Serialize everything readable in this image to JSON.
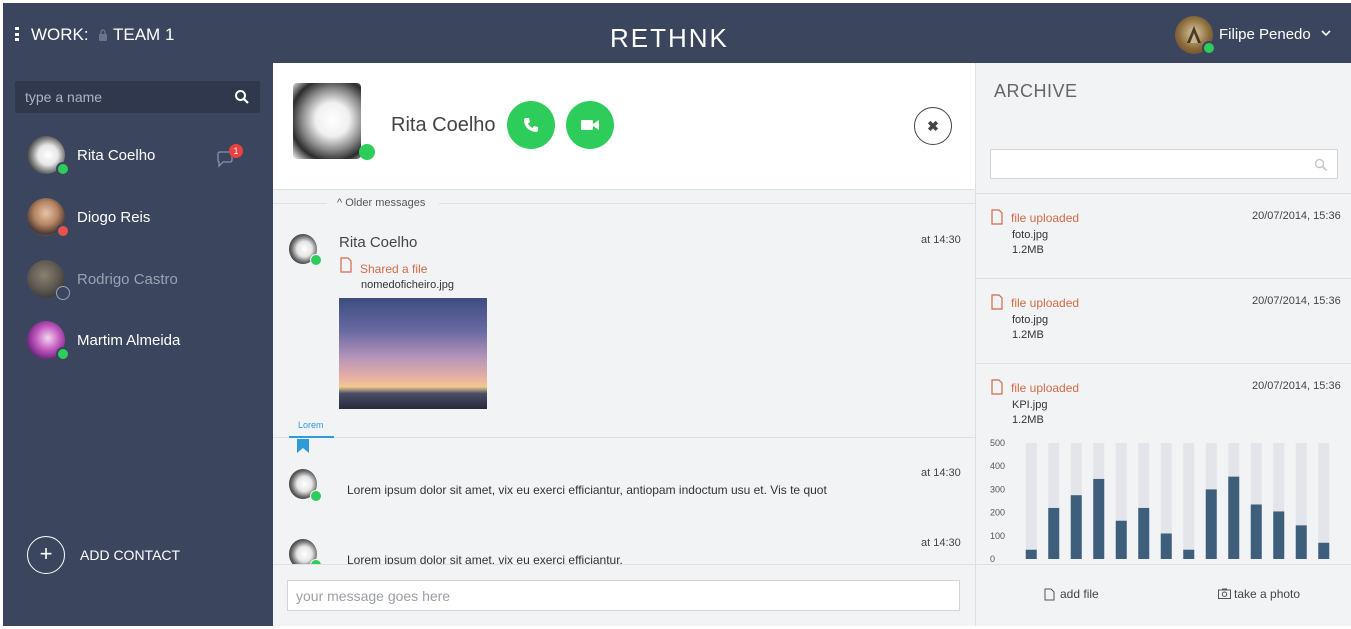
{
  "header": {
    "work_label": "WORK:",
    "team_label": "TEAM 1",
    "logo": "RETHNK",
    "user_name": "Filipe Penedo"
  },
  "sidebar": {
    "search_placeholder": "type a name",
    "contacts": [
      {
        "name": "Rita Coelho",
        "status": "online",
        "unread": "1"
      },
      {
        "name": "Diogo Reis",
        "status": "busy"
      },
      {
        "name": "Rodrigo Castro",
        "status": "offline"
      },
      {
        "name": "Martim Almeida",
        "status": "online"
      }
    ],
    "add_contact_label": "ADD CONTACT"
  },
  "chat": {
    "contact_name": "Rita Coelho",
    "older_messages_label": "Older messages",
    "messages": [
      {
        "author": "Rita Coelho",
        "time": "at 14:30",
        "shared_label": "Shared a file",
        "file_name": "nomedoficheiro.jpg"
      },
      {
        "time": "at 14:30",
        "text": "Lorem ipsum dolor sit amet, vix eu exerci efficiantur, antiopam indoctum usu et. Vis te quot"
      },
      {
        "time": "at 14:30",
        "text": "Lorem ipsum dolor sit amet, vix eu exerci efficiantur."
      }
    ],
    "bookmark_label": "Lorem",
    "composer_placeholder": "your message goes here"
  },
  "archive": {
    "title": "ARCHIVE",
    "items": [
      {
        "label": "file uploaded",
        "date": "20/07/2014, 15:36",
        "file": "foto.jpg",
        "size": "1.2MB"
      },
      {
        "label": "file uploaded",
        "date": "20/07/2014, 15:36",
        "file": "foto.jpg",
        "size": "1.2MB"
      },
      {
        "label": "file uploaded",
        "date": "20/07/2014, 15:36",
        "file": "KPI.jpg",
        "size": "1.2MB"
      }
    ],
    "add_file_label": "add file",
    "take_photo_label": "take a photo"
  },
  "chart_data": {
    "type": "bar",
    "y_ticks": [
      "500",
      "400",
      "300",
      "200",
      "100",
      "0"
    ],
    "ylim": [
      0,
      500
    ],
    "values": [
      40,
      220,
      275,
      345,
      165,
      220,
      110,
      40,
      300,
      355,
      235,
      205,
      145,
      70
    ],
    "bar_color": "#3e5f7c",
    "track_color": "#e3e5ea"
  },
  "colors": {
    "sidebar": "#3b465e",
    "online": "#2ecc5b",
    "busy": "#e8524a",
    "accent_orange": "#d36b45",
    "bookmark_blue": "#2f9bd8"
  }
}
